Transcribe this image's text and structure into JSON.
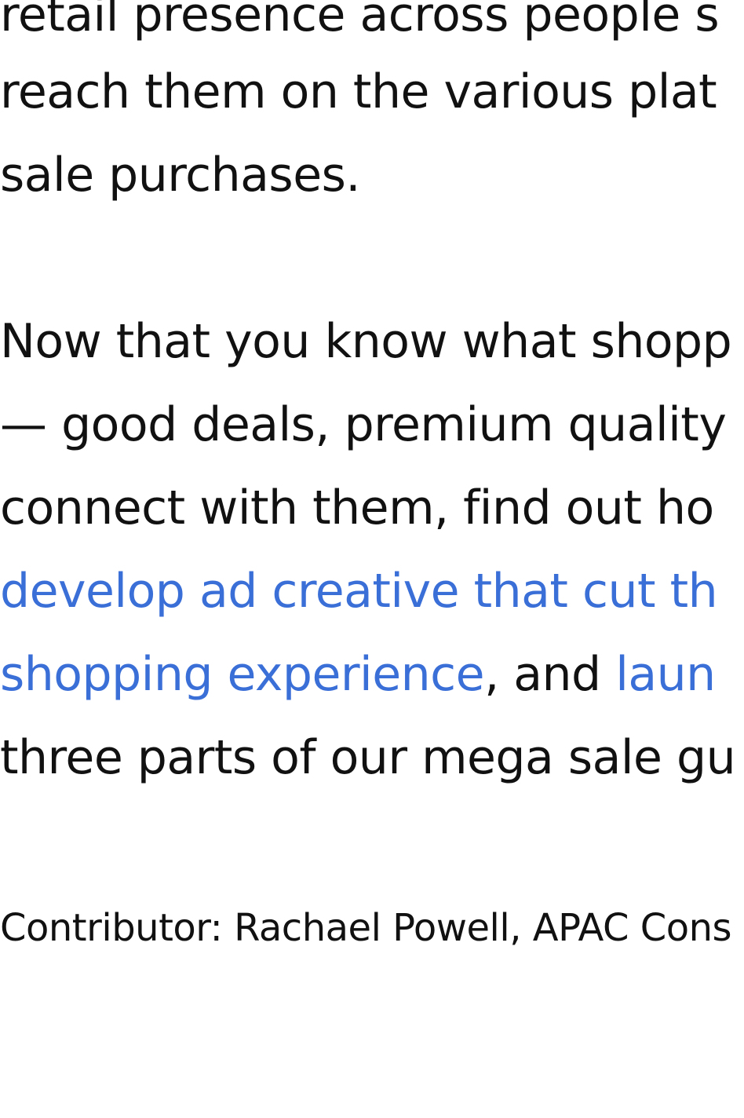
{
  "article": {
    "paragraph1": {
      "line1": "retail presence across people s",
      "line2": "reach them on the various plat",
      "line3": "sale purchases."
    },
    "paragraph2": {
      "line1": "Now that you know what shopp",
      "line2": "— good deals, premium quality",
      "line3": "connect with them, find out ho",
      "line4_link": "develop ad creative that cut th",
      "line5_link1": "shopping experience",
      "line5_text": ", and ",
      "line5_link2": "laun",
      "line6": "three parts of our mega sale gu"
    },
    "contributor": "Contributor: Rachael Powell, APAC Cons"
  },
  "colors": {
    "text": "#111111",
    "link": "#3b6fd8",
    "background": "#ffffff"
  }
}
